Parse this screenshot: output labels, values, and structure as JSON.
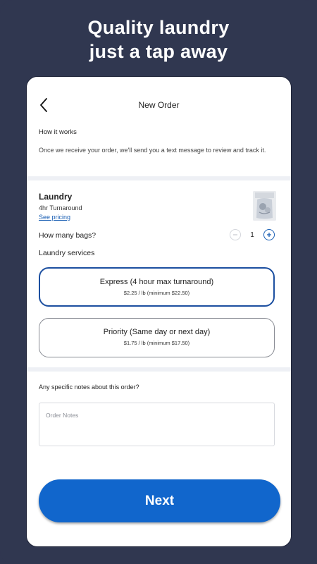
{
  "headline": {
    "line1": "Quality laundry",
    "line2": "just a tap away"
  },
  "header": {
    "title": "New Order",
    "back_icon": "chevron-left-icon"
  },
  "how_it_works": {
    "title": "How it works",
    "text": "Once we receive your order, we'll send you a text message to review and track it."
  },
  "laundry": {
    "title": "Laundry",
    "turnaround": "4hr Turnaround",
    "pricing_link": "See pricing",
    "bags_label": "How many bags?",
    "bags_count": "1",
    "services_label": "Laundry services"
  },
  "services": [
    {
      "name": "Express (4 hour max turnaround)",
      "price": "$2.25 / lb (minimum $22.50)",
      "selected": true
    },
    {
      "name": "Priority (Same day or next day)",
      "price": "$1.75 / lb (minimum $17.50)",
      "selected": false
    }
  ],
  "notes": {
    "label": "Any specific notes about this order?",
    "placeholder": "Order Notes"
  },
  "next_button": "Next",
  "colors": {
    "background": "#303750",
    "accent": "#1166cc",
    "selected_border": "#1c4fa0"
  }
}
